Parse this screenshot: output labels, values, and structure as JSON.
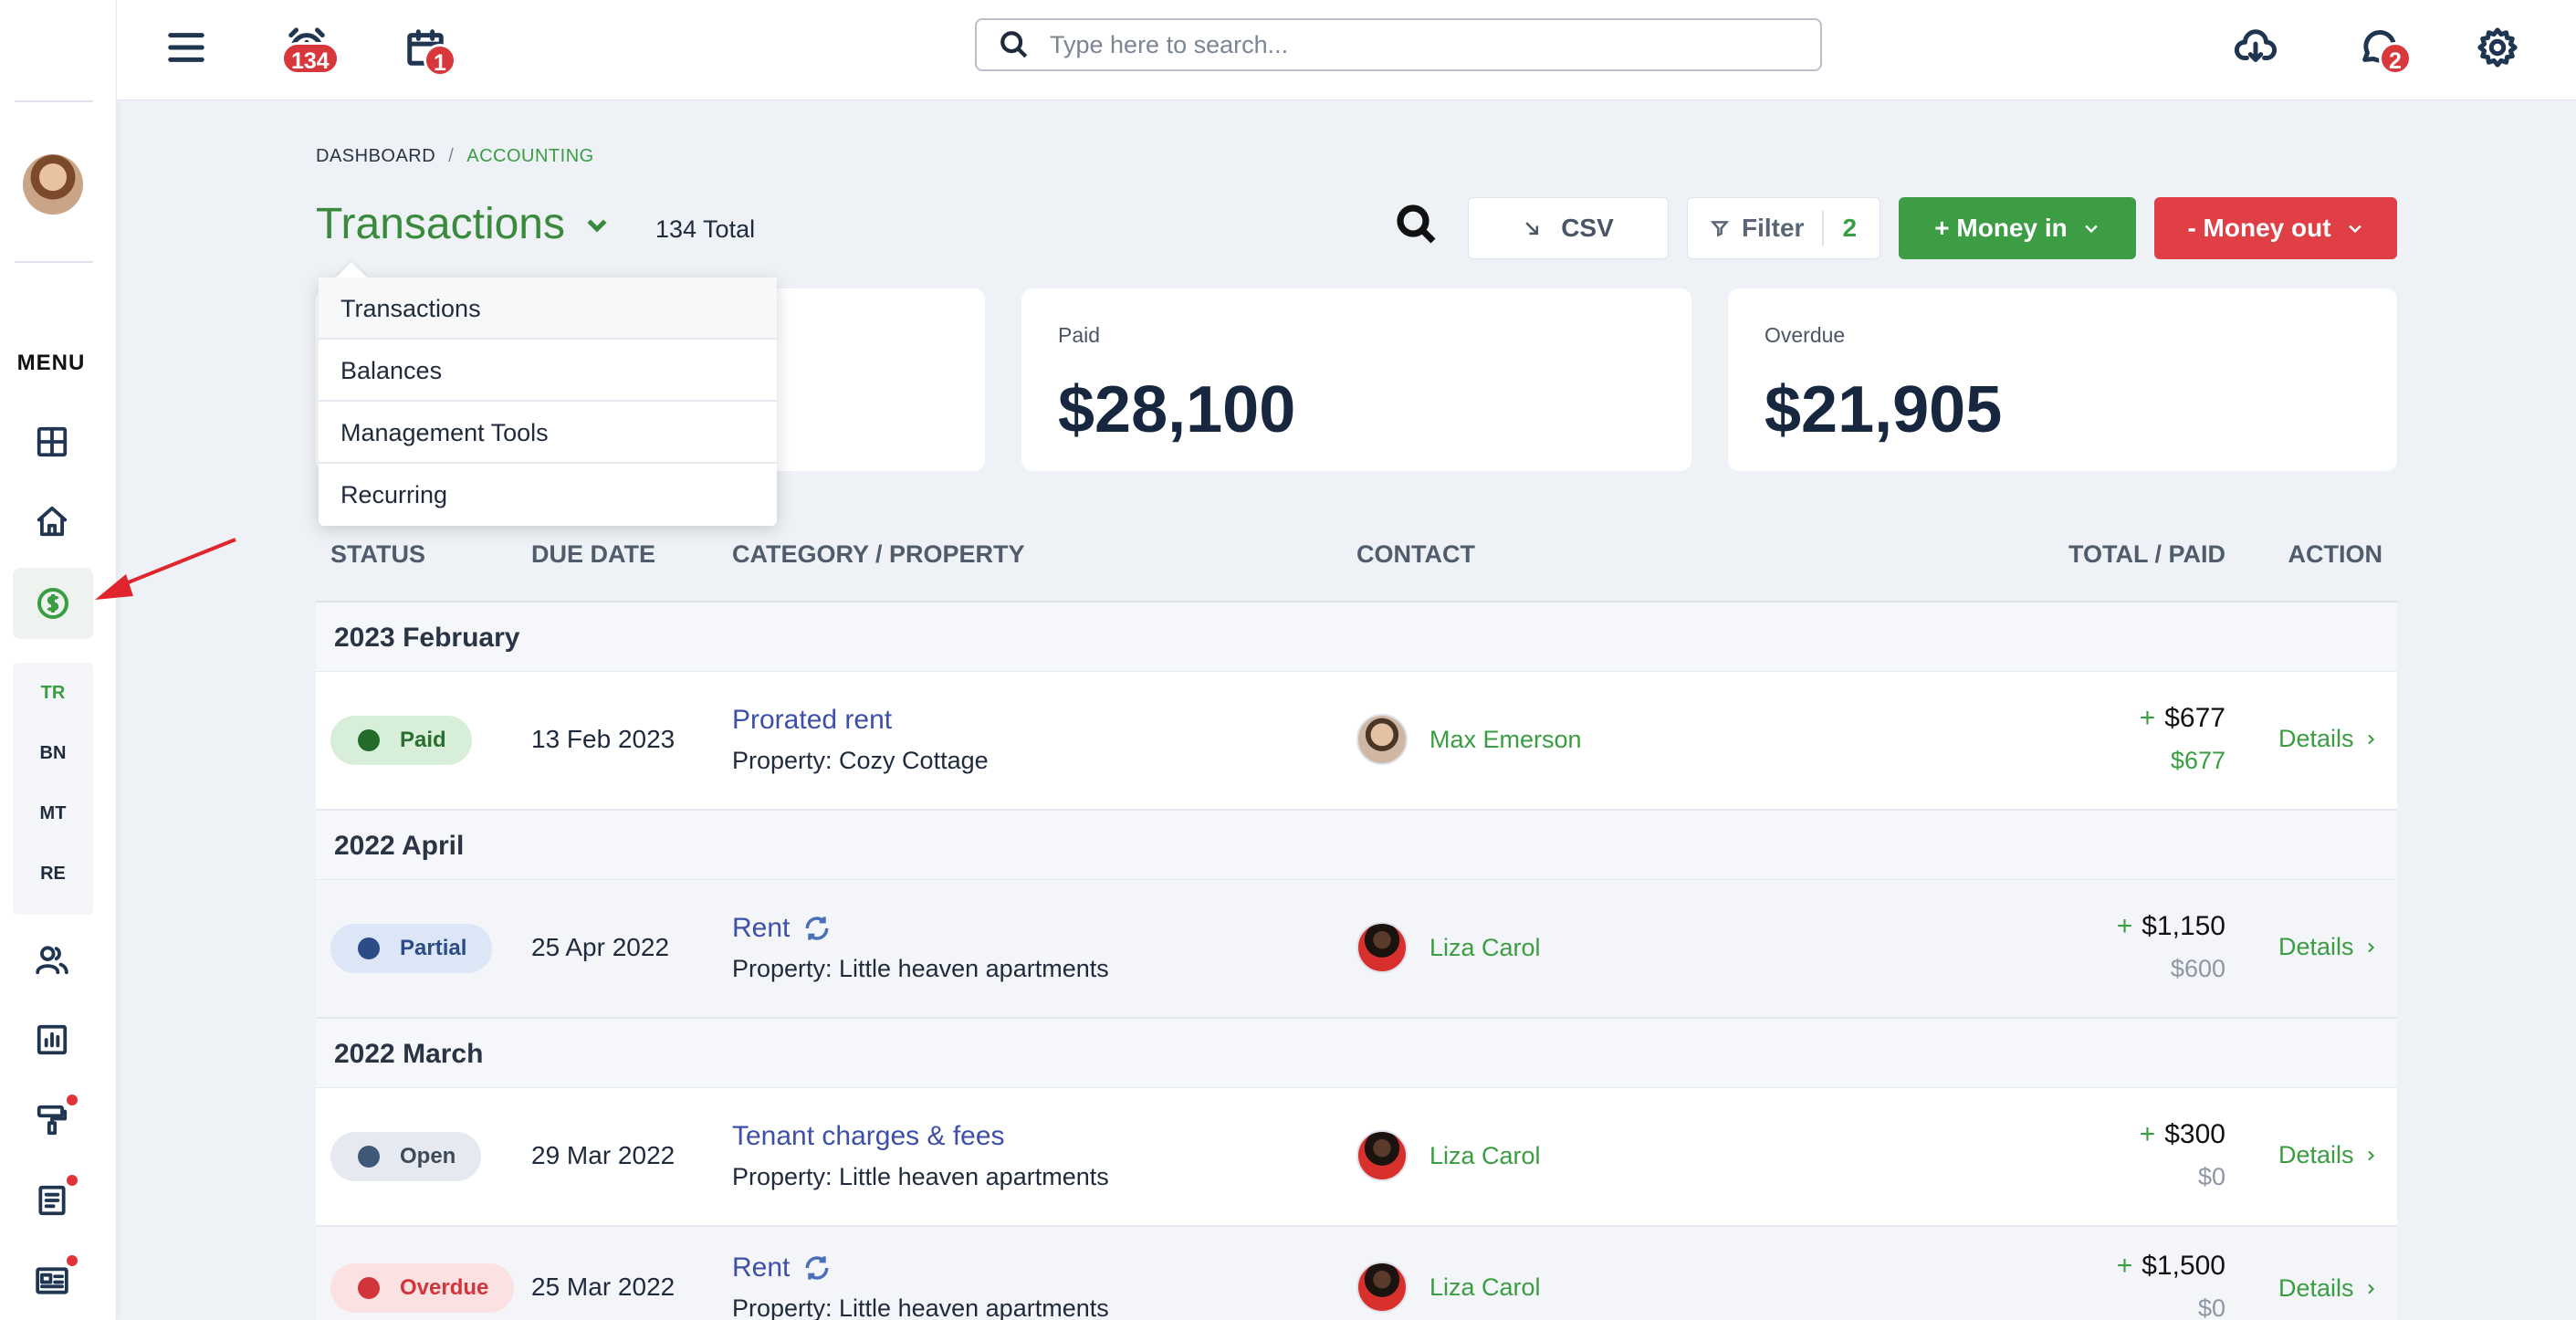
{
  "sidebar": {
    "menu_label": "MENU",
    "sub_items": [
      "TR",
      "BN",
      "MT",
      "RE"
    ]
  },
  "topbar": {
    "alerts_count": "134",
    "calendar_count": "1",
    "messages_count": "2",
    "search_placeholder": "Type here to search..."
  },
  "breadcrumb": {
    "root": "DASHBOARD",
    "separator": "/",
    "current": "ACCOUNTING"
  },
  "header": {
    "title": "Transactions",
    "total": "134 Total",
    "csv_label": "CSV",
    "filter_label": "Filter",
    "filter_count": "2",
    "money_in_label": "+ Money in",
    "money_out_label": "- Money out"
  },
  "cards": [
    {
      "label": "Paid",
      "value": "$28,100"
    },
    {
      "label": "Overdue",
      "value": "$21,905"
    }
  ],
  "dropdown": {
    "items": [
      "Transactions",
      "Balances",
      "Management Tools",
      "Recurring"
    ]
  },
  "table": {
    "headers": {
      "status": "STATUS",
      "due_date": "DUE DATE",
      "category": "CATEGORY / PROPERTY",
      "contact": "CONTACT",
      "total": "TOTAL / PAID",
      "action": "ACTION"
    },
    "groups": [
      "2023 February",
      "2022 April",
      "2022 March"
    ],
    "rows": [
      {
        "status": "Paid",
        "due": "13 Feb 2023",
        "category": "Prorated rent",
        "property": "Property: Cozy Cottage",
        "contact": "Max Emerson",
        "sign": "+",
        "total": "$677",
        "paid": "$677",
        "action": "Details"
      },
      {
        "status": "Partial",
        "due": "25 Apr 2022",
        "category": "Rent",
        "property": "Property: Little heaven apartments",
        "contact": "Liza Carol",
        "sign": "+",
        "total": "$1,150",
        "paid": "$600",
        "action": "Details"
      },
      {
        "status": "Open",
        "due": "29 Mar 2022",
        "category": "Tenant charges & fees",
        "property": "Property: Little heaven apartments",
        "contact": "Liza Carol",
        "sign": "+",
        "total": "$300",
        "paid": "$0",
        "action": "Details"
      },
      {
        "status": "Overdue",
        "due": "25 Mar 2022",
        "category": "Rent",
        "property": "Property: Little heaven apartments",
        "contact": "Liza Carol",
        "sign": "+",
        "total": "$1,500",
        "paid": "$0",
        "action": "Details"
      }
    ]
  },
  "colors": {
    "accent_green": "#3a9d42",
    "money_out_red": "#df3f45",
    "link_blue": "#3d4fa6"
  }
}
